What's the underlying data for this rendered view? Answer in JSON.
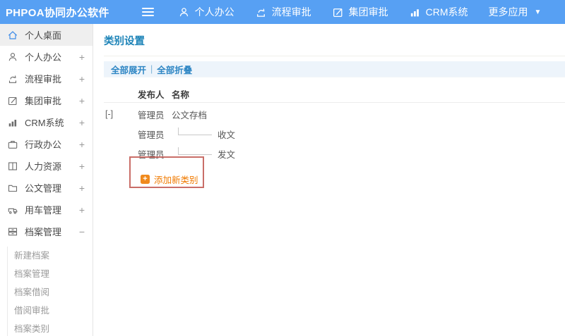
{
  "header": {
    "logo": "PHPOA协同办公软件",
    "nav": [
      {
        "label": "个人办公",
        "icon": "person-icon"
      },
      {
        "label": "流程审批",
        "icon": "flow-icon"
      },
      {
        "label": "集团审批",
        "icon": "edit-icon"
      },
      {
        "label": "CRM系统",
        "icon": "chart-icon"
      },
      {
        "label": "更多应用",
        "icon": "caret-down-icon"
      }
    ]
  },
  "sidebar": {
    "items": [
      {
        "label": "个人桌面",
        "icon": "home-icon",
        "expander": "",
        "active": true
      },
      {
        "label": "个人办公",
        "icon": "person-icon",
        "expander": "+"
      },
      {
        "label": "流程审批",
        "icon": "flow-icon",
        "expander": "+"
      },
      {
        "label": "集团审批",
        "icon": "edit-icon",
        "expander": "+"
      },
      {
        "label": "CRM系统",
        "icon": "chart-icon",
        "expander": "+"
      },
      {
        "label": "行政办公",
        "icon": "briefcase-icon",
        "expander": "+"
      },
      {
        "label": "人力资源",
        "icon": "book-icon",
        "expander": "+"
      },
      {
        "label": "公文管理",
        "icon": "folder-icon",
        "expander": "+"
      },
      {
        "label": "用车管理",
        "icon": "car-icon",
        "expander": "+"
      },
      {
        "label": "档案管理",
        "icon": "archive-icon",
        "expander": "−",
        "expanded": true
      }
    ],
    "submenu": [
      "新建档案",
      "档案管理",
      "档案借阅",
      "借阅审批",
      "档案类别"
    ]
  },
  "main": {
    "title": "类别设置",
    "toolbar": {
      "expand_all": "全部展开",
      "separator": "|",
      "collapse_all": "全部折叠"
    },
    "table": {
      "headers": {
        "publisher": "发布人",
        "name": "名称"
      },
      "rows": [
        {
          "expander": "[-]",
          "publisher": "管理员",
          "name": "公文存档",
          "child": false
        },
        {
          "expander": "",
          "publisher": "管理员",
          "name": "收文",
          "child": true
        },
        {
          "expander": "",
          "publisher": "管理员",
          "name": "发文",
          "child": true
        }
      ],
      "add_label": "添加新类别"
    }
  },
  "colors": {
    "header_bg": "#57a0f3",
    "title_text": "#1e84b8",
    "toolbar_bg": "#edf4fb",
    "link_blue": "#2e86c4",
    "accent_orange": "#f07a00",
    "plus_icon_bg": "#f08a1d",
    "annotation_border": "#c96e68",
    "active_item_bg": "#efefef"
  }
}
